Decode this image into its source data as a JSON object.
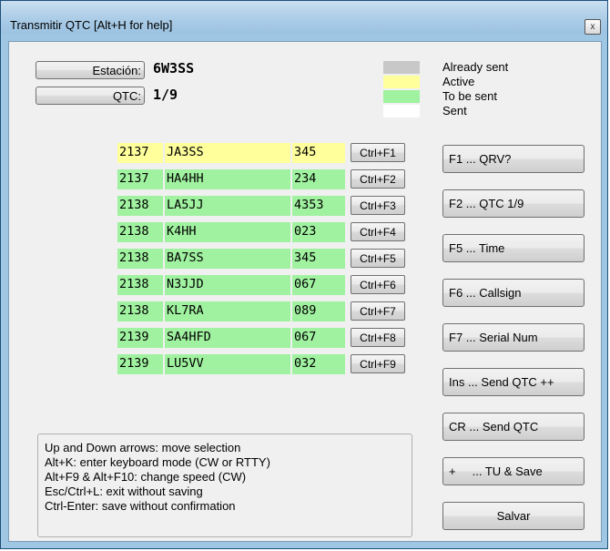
{
  "window": {
    "title": "Transmitir QTC [Alt+H for help]",
    "close_glyph": "x"
  },
  "station": {
    "label": "Estación:",
    "value": "6W3SS"
  },
  "qtc": {
    "label": "QTC:",
    "value": "1/9"
  },
  "legend": [
    {
      "color": "#c8c8c8",
      "label": "Already sent"
    },
    {
      "color": "#ffff9c",
      "label": "Active"
    },
    {
      "color": "#a0f2a0",
      "label": "To be sent"
    },
    {
      "color": "#ffffff",
      "label": "Sent"
    }
  ],
  "rows": [
    {
      "time": "2137",
      "call": "JA3SS",
      "serial": "345",
      "hotkey": "Ctrl+F1",
      "state": "active"
    },
    {
      "time": "2137",
      "call": "HA4HH",
      "serial": "234",
      "hotkey": "Ctrl+F2",
      "state": "to_be_sent"
    },
    {
      "time": "2138",
      "call": "LA5JJ",
      "serial": "4353",
      "hotkey": "Ctrl+F3",
      "state": "to_be_sent"
    },
    {
      "time": "2138",
      "call": "K4HH",
      "serial": "023",
      "hotkey": "Ctrl+F4",
      "state": "to_be_sent"
    },
    {
      "time": "2138",
      "call": "BA7SS",
      "serial": "345",
      "hotkey": "Ctrl+F5",
      "state": "to_be_sent"
    },
    {
      "time": "2138",
      "call": "N3JJD",
      "serial": "067",
      "hotkey": "Ctrl+F6",
      "state": "to_be_sent"
    },
    {
      "time": "2138",
      "call": "KL7RA",
      "serial": "089",
      "hotkey": "Ctrl+F7",
      "state": "to_be_sent"
    },
    {
      "time": "2139",
      "call": "SA4HFD",
      "serial": "067",
      "hotkey": "Ctrl+F8",
      "state": "to_be_sent"
    },
    {
      "time": "2139",
      "call": "LU5VV",
      "serial": "032",
      "hotkey": "Ctrl+F9",
      "state": "to_be_sent"
    }
  ],
  "actions": [
    "F1 ... QRV?",
    "F2 ... QTC 1/9",
    "F5 ... Time",
    "F6 ... Callsign",
    "F7 ... Serial Num",
    "Ins ... Send QTC ++",
    "CR ... Send QTC",
    "+     ... TU & Save",
    "Salvar"
  ],
  "help": [
    "Up and Down arrows: move selection",
    "Alt+K: enter keyboard mode (CW or RTTY)",
    "Alt+F9 & Alt+F10: change speed (CW)",
    "Esc/Ctrl+L: exit without saving",
    "Ctrl-Enter: save without confirmation"
  ]
}
